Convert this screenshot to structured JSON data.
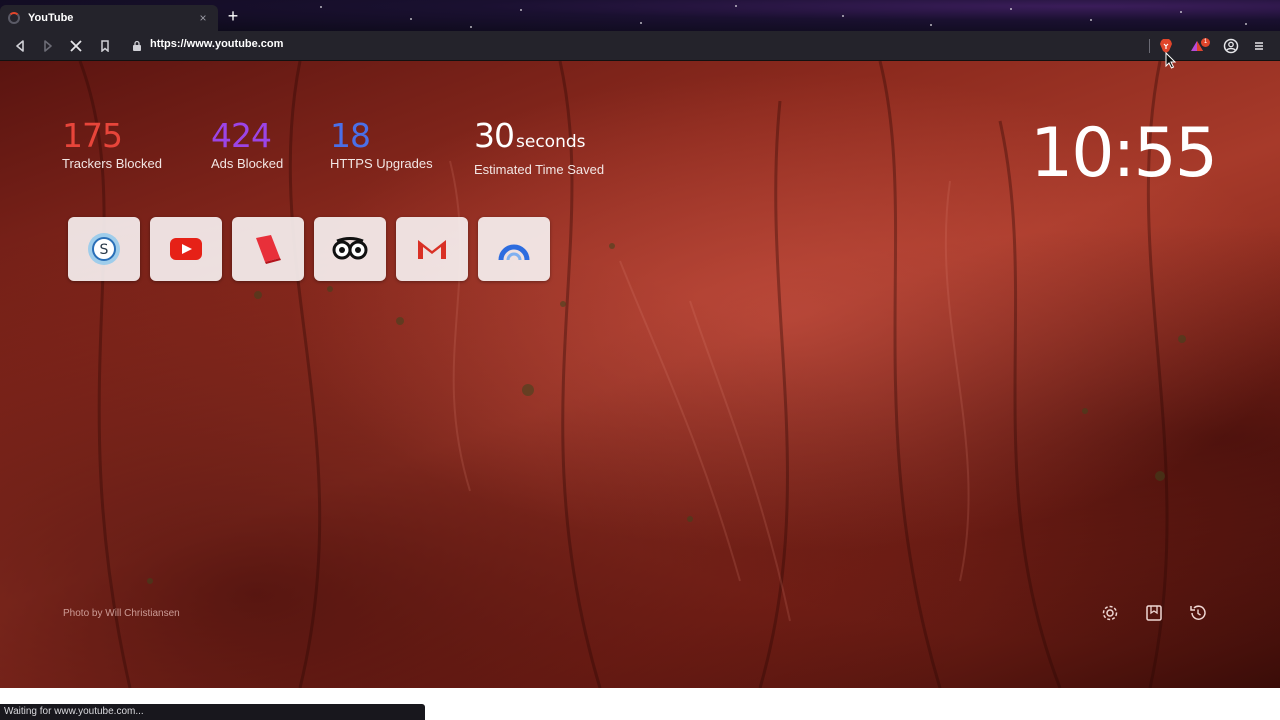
{
  "tab": {
    "title": "YouTube",
    "close_glyph": "×",
    "new_tab_glyph": "+"
  },
  "toolbar": {
    "url": "https://www.youtube.com",
    "shields_badge_count": "1"
  },
  "stats": [
    {
      "value": "175",
      "unit": "",
      "label": "Trackers Blocked",
      "color": "#e8453a"
    },
    {
      "value": "424",
      "unit": "",
      "label": "Ads Blocked",
      "color": "#9b45e6"
    },
    {
      "value": "18",
      "unit": "",
      "label": "HTTPS Upgrades",
      "color": "#4a6fe8"
    },
    {
      "value": "30",
      "unit": "seconds",
      "label": "Estimated Time Saved",
      "color": "#ffffff"
    }
  ],
  "clock": {
    "time": "10:55"
  },
  "top_sites": [
    {
      "icon": "skype-style-icon"
    },
    {
      "icon": "youtube-icon"
    },
    {
      "icon": "red-book-icon"
    },
    {
      "icon": "tripadvisor-icon"
    },
    {
      "icon": "gmail-icon"
    },
    {
      "icon": "blue-arc-icon"
    }
  ],
  "photo_credit": "Photo by Will Christiansen",
  "ntp_actions": [
    "gear-icon",
    "bookmarks-icon",
    "history-icon"
  ],
  "status": {
    "text": "Waiting for www.youtube.com..."
  },
  "colors": {
    "accent_red": "#e0452b",
    "toolbar_bg": "#24232b"
  }
}
